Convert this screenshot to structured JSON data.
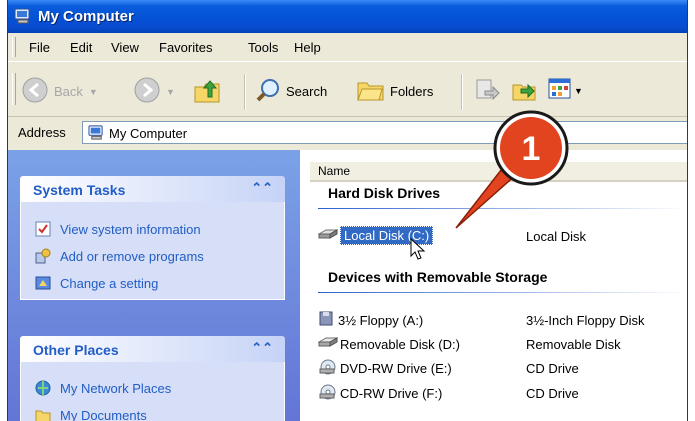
{
  "window": {
    "title": "My Computer"
  },
  "menu": [
    "File",
    "Edit",
    "View",
    "Favorites",
    "Tools",
    "Help"
  ],
  "toolbar": {
    "back": "Back",
    "search": "Search",
    "folders": "Folders"
  },
  "address": {
    "label": "Address",
    "value": "My Computer"
  },
  "left_pane": {
    "system_tasks": {
      "title": "System Tasks",
      "items": [
        "View system information",
        "Add or remove programs",
        "Change a setting"
      ]
    },
    "other_places": {
      "title": "Other Places",
      "items": [
        "My Network Places",
        "My Documents"
      ]
    }
  },
  "content": {
    "column_header": "Name",
    "groups": [
      {
        "title": "Hard Disk Drives",
        "items": [
          {
            "name": "Local Disk (C:)",
            "type": "Local Disk",
            "selected": true
          }
        ]
      },
      {
        "title": "Devices with Removable Storage",
        "items": [
          {
            "name": "3½ Floppy (A:)",
            "type": "3½-Inch Floppy Disk"
          },
          {
            "name": "Removable Disk (D:)",
            "type": "Removable Disk"
          },
          {
            "name": "DVD-RW Drive (E:)",
            "type": "CD Drive"
          },
          {
            "name": "CD-RW Drive (F:)",
            "type": "CD Drive"
          }
        ]
      }
    ]
  },
  "callout": {
    "number": "1",
    "color": "#e2441f"
  },
  "colors": {
    "titlebar": "#0a5ddc",
    "link": "#215dc6",
    "selection": "#316ac5"
  },
  "icons": [
    "my-computer-icon",
    "back-icon",
    "forward-icon",
    "up-folder-icon",
    "search-icon",
    "folders-icon",
    "move-to-icon",
    "copy-to-icon",
    "views-icon",
    "hard-disk-icon",
    "floppy-icon",
    "removable-disk-icon",
    "dvd-drive-icon",
    "cd-drive-icon",
    "network-icon",
    "documents-icon",
    "cursor-icon"
  ]
}
